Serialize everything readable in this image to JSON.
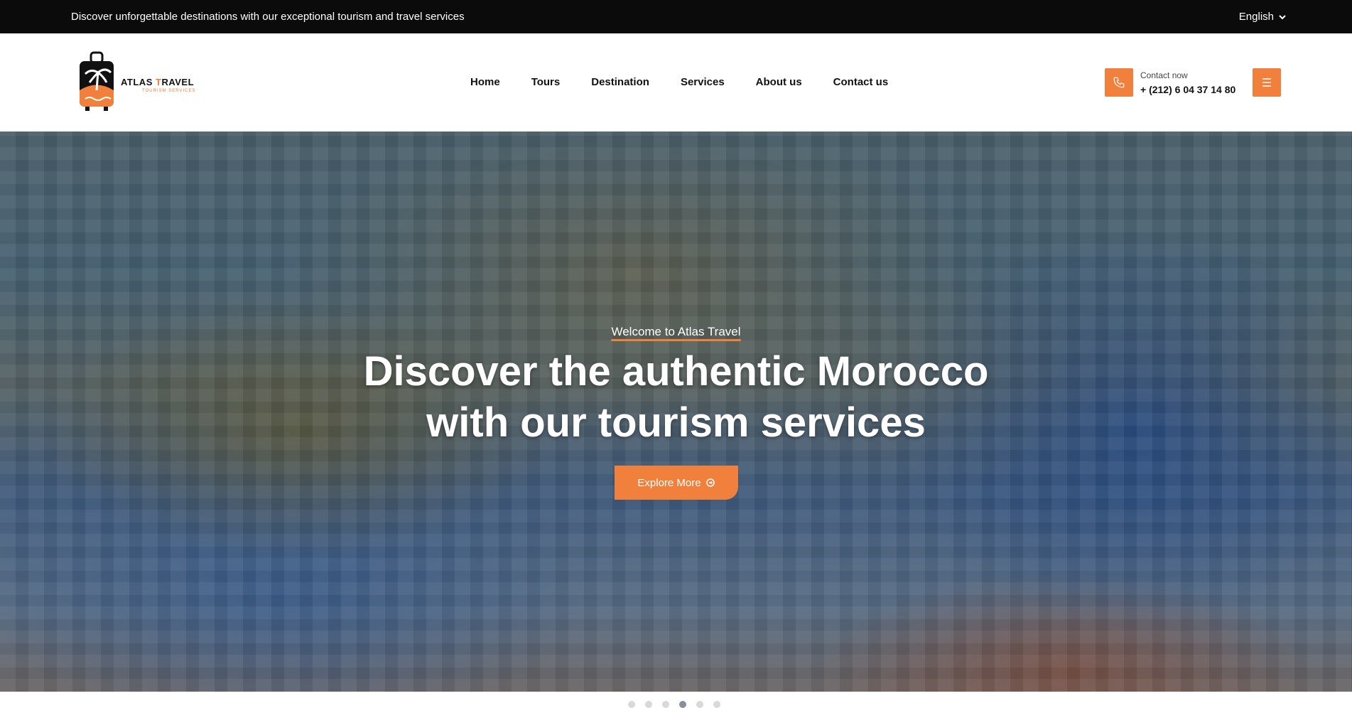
{
  "topbar": {
    "message": "Discover unforgettable destinations with our exceptional tourism and travel services",
    "language": "English"
  },
  "header": {
    "logo": {
      "brand_main": "ATLAS ",
      "brand_accent": "T",
      "brand_rest": "RAVEL",
      "tagline": "TOURISM SERVICES"
    },
    "nav": [
      "Home",
      "Tours",
      "Destination",
      "Services",
      "About us",
      "Contact us"
    ],
    "contact": {
      "label": "Contact now",
      "phone": "+ (212) 6 04 37 14 80"
    }
  },
  "hero": {
    "welcome": "Welcome to Atlas Travel",
    "headline_line1": "Discover the authentic Morocco",
    "headline_line2": "with our tourism services",
    "cta": "Explore More"
  },
  "slider": {
    "count": 6,
    "active_index": 3
  },
  "colors": {
    "accent": "#f0803c",
    "topbar_bg": "#0b0b0b",
    "dot_inactive": "#d9d9d9",
    "dot_active": "#8a8f99"
  },
  "icons": {
    "language": "chevron-down-icon",
    "contact": "phone-icon",
    "menu": "hamburger-icon",
    "cta": "arrow-circle-icon"
  }
}
